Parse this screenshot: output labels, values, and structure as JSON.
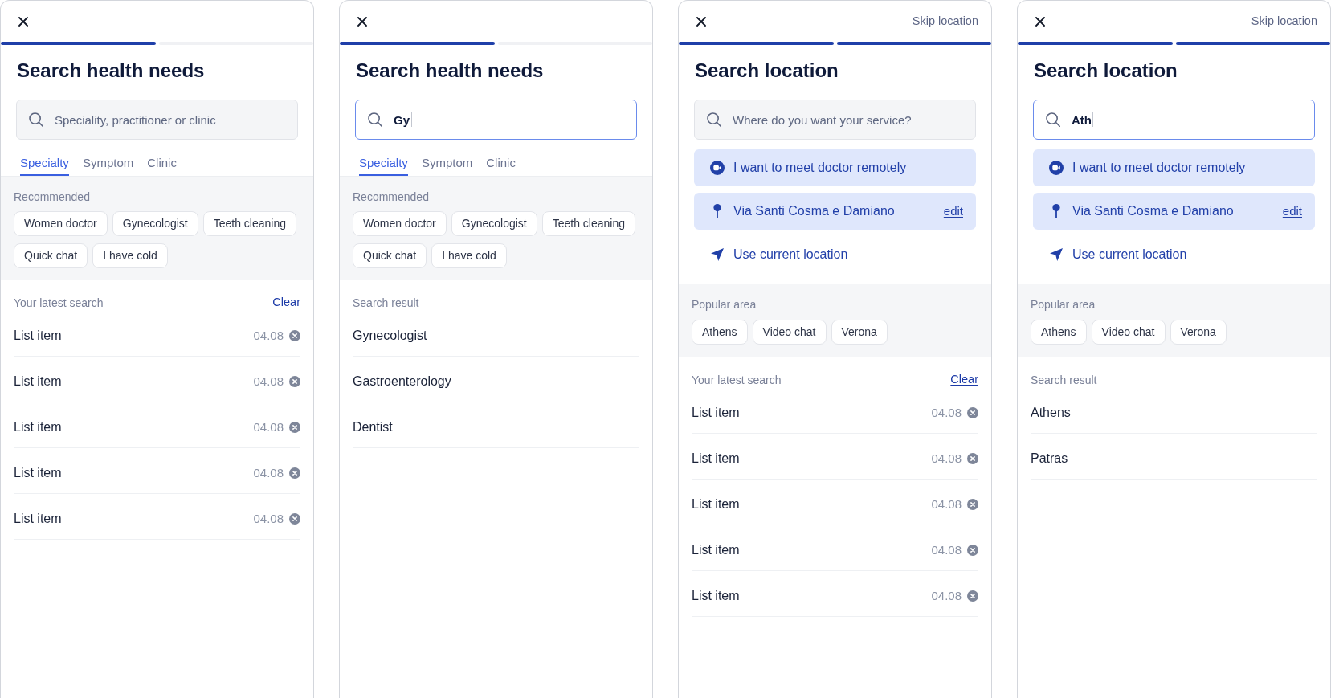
{
  "screens": [
    {
      "progress_steps": [
        {
          "complete": true
        },
        {
          "complete": false
        }
      ],
      "title": "Search health needs",
      "search": {
        "placeholder": "Speciality, practitioner or clinic",
        "focused": false
      },
      "tabs": [
        {
          "label": "Specialty",
          "selected": true
        },
        {
          "label": "Symptom",
          "selected": false
        },
        {
          "label": "Clinic",
          "selected": false
        }
      ],
      "sections": [
        {
          "kind": "chips",
          "heading": "Recommended",
          "chips": [
            "Women doctor",
            "Gynecologist",
            "Teeth cleaning",
            "Quick chat",
            "I have cold"
          ]
        },
        {
          "kind": "recent",
          "heading": "Your latest search",
          "action": "Clear",
          "items": [
            {
              "label": "List item",
              "date": "04.08"
            },
            {
              "label": "List item",
              "date": "04.08"
            },
            {
              "label": "List item",
              "date": "04.08"
            },
            {
              "label": "List item",
              "date": "04.08"
            },
            {
              "label": "List item",
              "date": "04.08"
            }
          ]
        }
      ]
    },
    {
      "progress_steps": [
        {
          "complete": true
        },
        {
          "complete": false
        }
      ],
      "title": "Search health needs",
      "search": {
        "value": "Gy",
        "focused": true
      },
      "tabs": [
        {
          "label": "Specialty",
          "selected": true
        },
        {
          "label": "Symptom",
          "selected": false
        },
        {
          "label": "Clinic",
          "selected": false
        }
      ],
      "sections": [
        {
          "kind": "chips",
          "heading": "Recommended",
          "chips": [
            "Women doctor",
            "Gynecologist",
            "Teeth cleaning",
            "Quick chat",
            "I have cold"
          ]
        },
        {
          "kind": "results",
          "heading": "Search result",
          "items": [
            {
              "label": "Gynecologist"
            },
            {
              "label": "Gastroenterology"
            },
            {
              "label": "Dentist"
            }
          ]
        }
      ]
    },
    {
      "skip_link": "Skip location",
      "progress_steps": [
        {
          "complete": true
        },
        {
          "complete": true
        }
      ],
      "title": "Search location",
      "search": {
        "placeholder": "Where do you want your service?",
        "focused": false
      },
      "options": [
        {
          "kind": "remote",
          "label": "I want to meet doctor remotely"
        },
        {
          "kind": "address",
          "label": "Via Santi Cosma e Damiano",
          "action": "edit"
        },
        {
          "kind": "current",
          "label": "Use current location"
        }
      ],
      "sections": [
        {
          "kind": "chips",
          "heading": "Popular area",
          "chips": [
            "Athens",
            "Video chat",
            "Verona"
          ]
        },
        {
          "kind": "recent",
          "heading": "Your latest search",
          "action": "Clear",
          "items": [
            {
              "label": "List item",
              "date": "04.08"
            },
            {
              "label": "List item",
              "date": "04.08"
            },
            {
              "label": "List item",
              "date": "04.08"
            },
            {
              "label": "List item",
              "date": "04.08"
            },
            {
              "label": "List item",
              "date": "04.08"
            }
          ]
        }
      ]
    },
    {
      "skip_link": "Skip location",
      "progress_steps": [
        {
          "complete": true
        },
        {
          "complete": true
        }
      ],
      "title": "Search location",
      "search": {
        "value": "Ath",
        "focused": true
      },
      "options": [
        {
          "kind": "remote",
          "label": "I want to meet doctor remotely"
        },
        {
          "kind": "address",
          "label": "Via Santi Cosma e Damiano",
          "action": "edit"
        },
        {
          "kind": "current",
          "label": "Use current location"
        }
      ],
      "sections": [
        {
          "kind": "chips",
          "heading": "Popular area",
          "chips": [
            "Athens",
            "Video chat",
            "Verona"
          ]
        },
        {
          "kind": "results",
          "heading": "Search result",
          "items": [
            {
              "label": "Athens"
            },
            {
              "label": "Patras"
            }
          ]
        }
      ]
    }
  ]
}
